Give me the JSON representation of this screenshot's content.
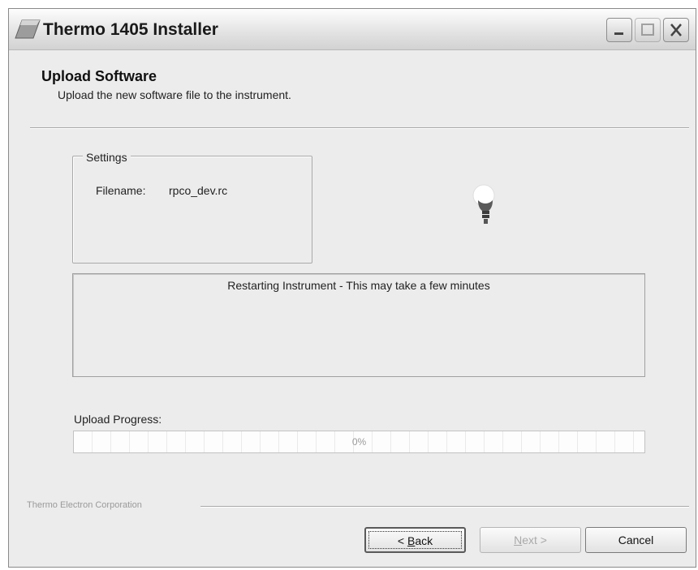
{
  "window": {
    "title": "Thermo 1405 Installer"
  },
  "header": {
    "title": "Upload Software",
    "subtitle": "Upload the new software file to the instrument."
  },
  "settings": {
    "group_label": "Settings",
    "filename_label": "Filename:",
    "filename_value": "rpco_dev.rc"
  },
  "status": {
    "message": "Restarting Instrument - This may take a few minutes"
  },
  "progress": {
    "label": "Upload Progress:",
    "value_percent": 0,
    "text": "0%"
  },
  "footer": {
    "company": "Thermo Electron Corporation"
  },
  "buttons": {
    "back_prefix": "< ",
    "back_access": "B",
    "back_rest": "ack",
    "next_access": "N",
    "next_rest": "ext >",
    "cancel": "Cancel"
  },
  "icons": {
    "app": "installer-app-icon",
    "minimize": "minimize-icon",
    "maximize": "maximize-icon",
    "close": "close-icon",
    "status": "lightbulb-icon"
  }
}
